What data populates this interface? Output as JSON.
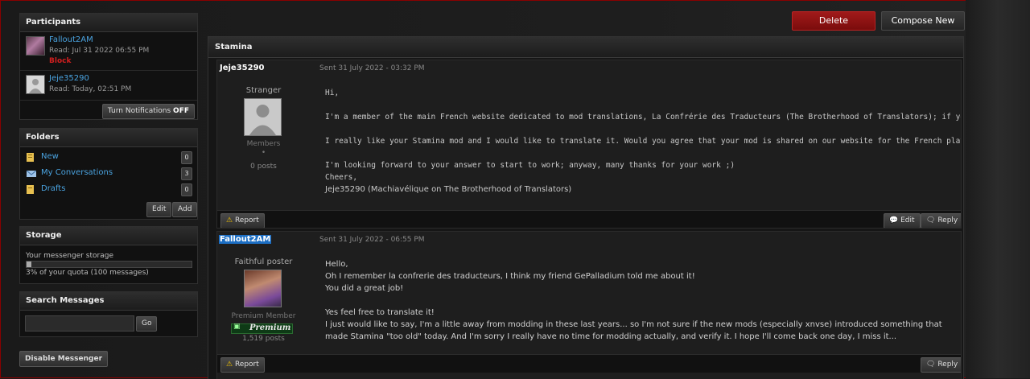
{
  "sidebar": {
    "participants": {
      "title": "Participants",
      "items": [
        {
          "name": "Fallout2AM",
          "read": "Read: Jul 31 2022 06:55 PM",
          "action": "Block"
        },
        {
          "name": "Jeje35290",
          "read": "Read: Today, 02:51 PM"
        }
      ],
      "notifications_label": "Turn Notifications",
      "notifications_state": "OFF"
    },
    "folders": {
      "title": "Folders",
      "items": [
        {
          "label": "New",
          "count": "0"
        },
        {
          "label": "My Conversations",
          "count": "3"
        },
        {
          "label": "Drafts",
          "count": "0"
        }
      ],
      "edit_label": "Edit",
      "add_label": "Add"
    },
    "storage": {
      "title": "Storage",
      "label": "Your messenger storage",
      "used_percent": 3,
      "quota_text": "3% of your quota (100 messages)"
    },
    "search": {
      "title": "Search Messages",
      "value": "",
      "go_label": "Go"
    },
    "disable_label": "Disable Messenger"
  },
  "header": {
    "delete_label": "Delete",
    "compose_label": "Compose New"
  },
  "conversation": {
    "title": "Stamina",
    "messages": [
      {
        "author": "Jeje35290",
        "sent": "Sent 31 July 2022 - 03:32 PM",
        "rank": "Stranger",
        "group": "Members",
        "dot": "•",
        "posts": "0 posts",
        "lines": [
          "Hi,",
          "",
          "I'm a member of the main French website dedicated to mod translations, La Confrérie des Traducteurs (The Brotherhood of Translators); if you want, you can see https://www.confr",
          "",
          "I really like your Stamina mod and I would like to translate it. Would you agree that your mod is shared on our website for the French players? Of course the page, topic and re",
          "",
          "I'm looking forward to your answer to start to work; anyway, many thanks for your work ;)",
          "Cheers,"
        ],
        "signature": "Jeje35290 (Machiavélique on The Brotherhood of Translators)",
        "report_label": "Report",
        "edit_label": "Edit",
        "reply_label": "Reply"
      },
      {
        "author": "Fallout2AM",
        "sent": "Sent 31 July 2022 - 06:55 PM",
        "rank": "Faithful poster",
        "group": "Premium Member",
        "badge": "Premium",
        "posts": "1,519 posts",
        "lines": [
          "Hello,",
          "Oh I remember la confrerie des traducteurs, I think my friend GePalladium told me about it!",
          "You did a great job!",
          "",
          "Yes feel free to translate it!",
          "I just would like to say, I'm a little away from modding in these last years... so I'm not sure if the new mods (especially xnvse) introduced something that made Stamina \"too old\" today. And I'm sorry I really have no time for modding actually, and verify it. I hope I'll come back one day, I miss it..."
        ],
        "report_label": "Report",
        "reply_label": "Reply"
      }
    ]
  }
}
